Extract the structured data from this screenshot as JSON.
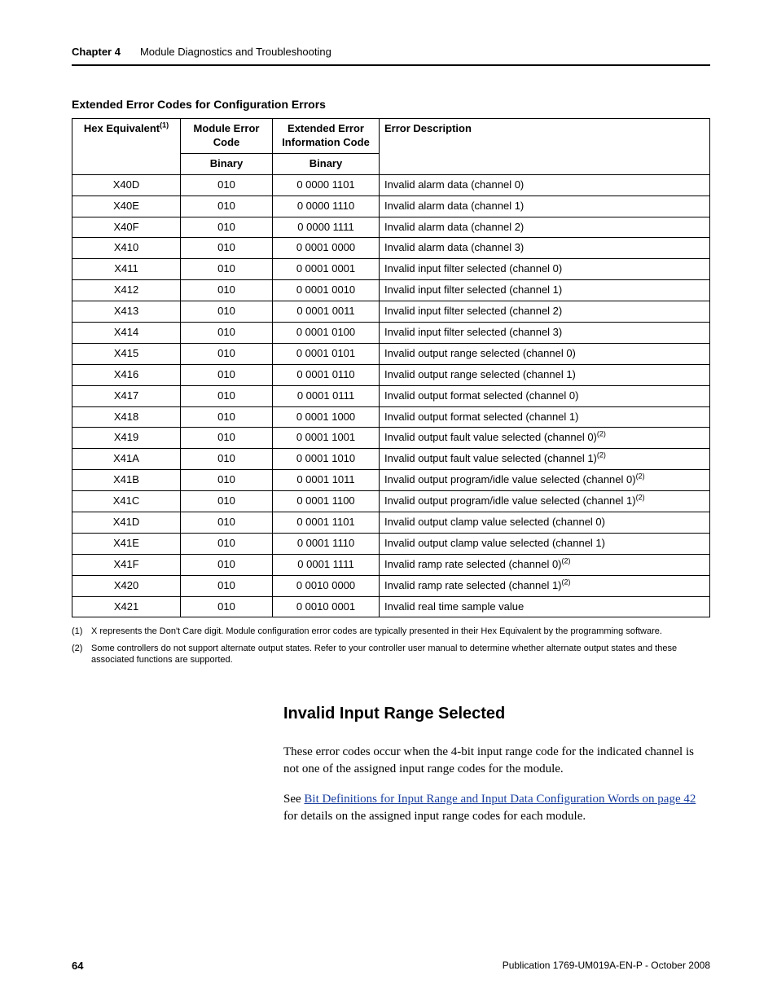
{
  "header": {
    "chapter_label": "Chapter 4",
    "chapter_title": "Module Diagnostics and Troubleshooting"
  },
  "table_title": "Extended Error Codes for Configuration Errors",
  "headers": {
    "hex_html": "Hex Equivalent<sup>(1)</sup>",
    "mod": "Module Error Code",
    "ext": "Extended Error Information Code",
    "desc": "Error Description",
    "binary": "Binary"
  },
  "rows": [
    {
      "hex": "X40D",
      "mod": "010",
      "ext": "0 0000 1101",
      "desc": "Invalid alarm data (channel 0)"
    },
    {
      "hex": "X40E",
      "mod": "010",
      "ext": "0 0000 1110",
      "desc": "Invalid alarm data (channel 1)"
    },
    {
      "hex": "X40F",
      "mod": "010",
      "ext": "0 0000 1111",
      "desc": "Invalid alarm data (channel 2)"
    },
    {
      "hex": "X410",
      "mod": "010",
      "ext": "0 0001 0000",
      "desc": "Invalid alarm data (channel 3)"
    },
    {
      "hex": "X411",
      "mod": "010",
      "ext": "0 0001 0001",
      "desc": "Invalid input filter selected (channel 0)"
    },
    {
      "hex": "X412",
      "mod": "010",
      "ext": "0 0001 0010",
      "desc": "Invalid input filter selected (channel 1)"
    },
    {
      "hex": "X413",
      "mod": "010",
      "ext": "0 0001 0011",
      "desc": "Invalid input filter selected (channel 2)"
    },
    {
      "hex": "X414",
      "mod": "010",
      "ext": "0 0001 0100",
      "desc": "Invalid input filter selected (channel 3)"
    },
    {
      "hex": "X415",
      "mod": "010",
      "ext": "0 0001 0101",
      "desc": "Invalid output range selected (channel 0)"
    },
    {
      "hex": "X416",
      "mod": "010",
      "ext": "0 0001 0110",
      "desc": "Invalid output range selected (channel 1)"
    },
    {
      "hex": "X417",
      "mod": "010",
      "ext": "0 0001 0111",
      "desc": "Invalid output format selected (channel 0)"
    },
    {
      "hex": "X418",
      "mod": "010",
      "ext": "0 0001 1000",
      "desc": "Invalid output format selected (channel 1)"
    },
    {
      "hex": "X419",
      "mod": "010",
      "ext": "0 0001 1001",
      "desc_html": "Invalid output fault value selected (channel 0)<sup>(2)</sup>"
    },
    {
      "hex": "X41A",
      "mod": "010",
      "ext": "0 0001 1010",
      "desc_html": "Invalid output fault value selected (channel 1)<sup>(2)</sup>"
    },
    {
      "hex": "X41B",
      "mod": "010",
      "ext": "0 0001 1011",
      "desc_html": "Invalid output program/idle value selected (channel 0)<sup>(2)</sup>"
    },
    {
      "hex": "X41C",
      "mod": "010",
      "ext": "0 0001 1100",
      "desc_html": "Invalid output program/idle value selected (channel 1)<sup>(2)</sup>"
    },
    {
      "hex": "X41D",
      "mod": "010",
      "ext": "0 0001 1101",
      "desc": "Invalid output clamp value selected (channel 0)"
    },
    {
      "hex": "X41E",
      "mod": "010",
      "ext": "0 0001 1110",
      "desc": "Invalid output clamp value selected (channel 1)"
    },
    {
      "hex": "X41F",
      "mod": "010",
      "ext": "0 0001 1111",
      "desc_html": "Invalid ramp rate selected (channel 0)<sup>(2)</sup>"
    },
    {
      "hex": "X420",
      "mod": "010",
      "ext": "0 0010 0000",
      "desc_html": "Invalid ramp rate selected (channel 1)<sup>(2)</sup>"
    },
    {
      "hex": "X421",
      "mod": "010",
      "ext": "0 0010 0001",
      "desc": "Invalid real time sample value"
    }
  ],
  "footnotes": [
    {
      "num": "(1)",
      "text": "X represents the Don't Care digit. Module configuration error codes are typically presented in their Hex Equivalent by the programming software."
    },
    {
      "num": "(2)",
      "text": "Some controllers do not support alternate output states. Refer to your controller user manual to determine whether alternate output states and these associated functions are supported."
    }
  ],
  "section": {
    "heading": "Invalid Input Range Selected",
    "para1": "These error codes occur when the 4-bit input range code for the indicated channel is not one of the assigned input range codes for the module.",
    "para2_pre": "See ",
    "para2_link": "Bit Definitions for Input Range and Input Data Configuration Words on page 42",
    "para2_post": " for details on the assigned input range codes for each module."
  },
  "footer": {
    "page": "64",
    "pub": "Publication 1769-UM019A-EN-P - October 2008"
  }
}
